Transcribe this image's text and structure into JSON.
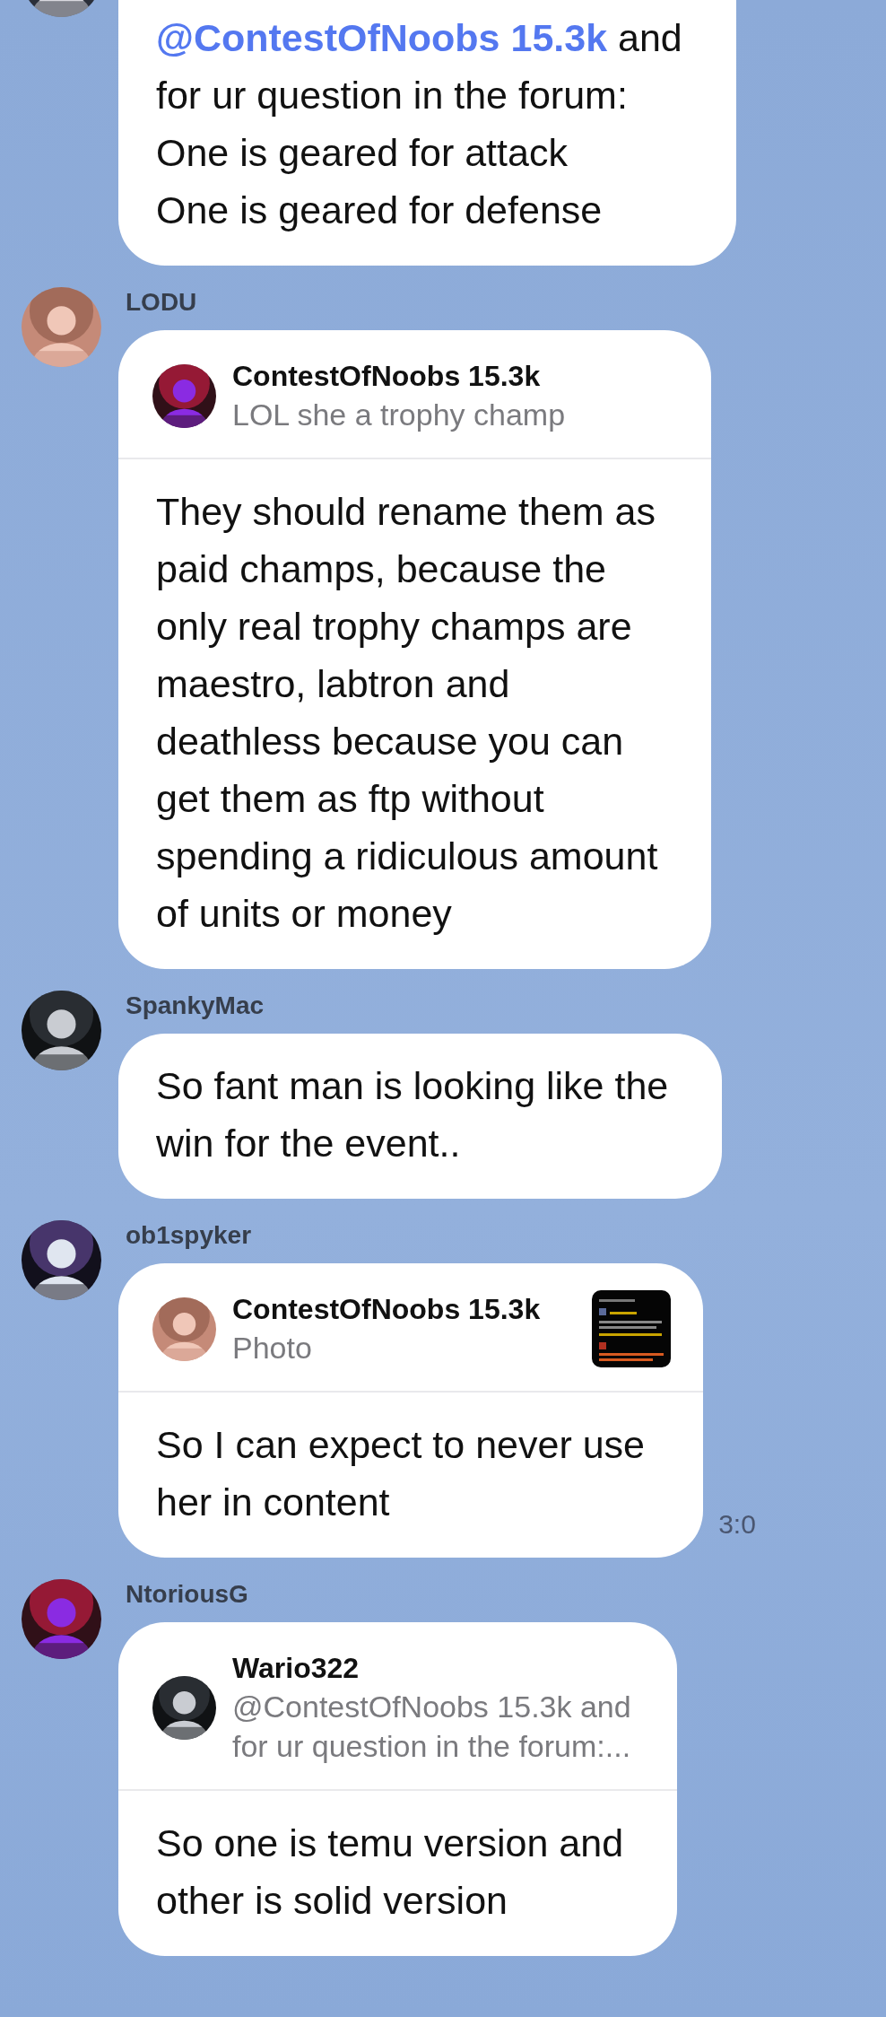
{
  "messages": [
    {
      "mention": "@ContestOfNoobs 15.3k",
      "text": "and\nfor ur question in the forum:\nOne is geared for attack\nOne is geared for defense"
    },
    {
      "sender": "LODU",
      "reply": {
        "author": "ContestOfNoobs 15.3k",
        "preview": "LOL she a trophy champ"
      },
      "text": "They should rename them as\npaid champs, because the\nonly real trophy champs are\nmaestro, labtron and\ndeathless because you can\nget them as ftp without\nspending a ridiculous amount\nof units or money"
    },
    {
      "sender": "SpankyMac",
      "text": "So fant man is looking like the\nwin for the event.."
    },
    {
      "sender": "ob1spyker",
      "reply": {
        "author": "ContestOfNoobs 15.3k",
        "preview": "Photo"
      },
      "text": "So I can expect to never use\nher in content",
      "time": "3:0"
    },
    {
      "sender": "NtoriousG",
      "reply": {
        "author": "Wario322",
        "preview": "@ContestOfNoobs 15.3k and\nfor ur question in the forum:..."
      },
      "text": "So one is temu version and\nother is solid version"
    }
  ]
}
